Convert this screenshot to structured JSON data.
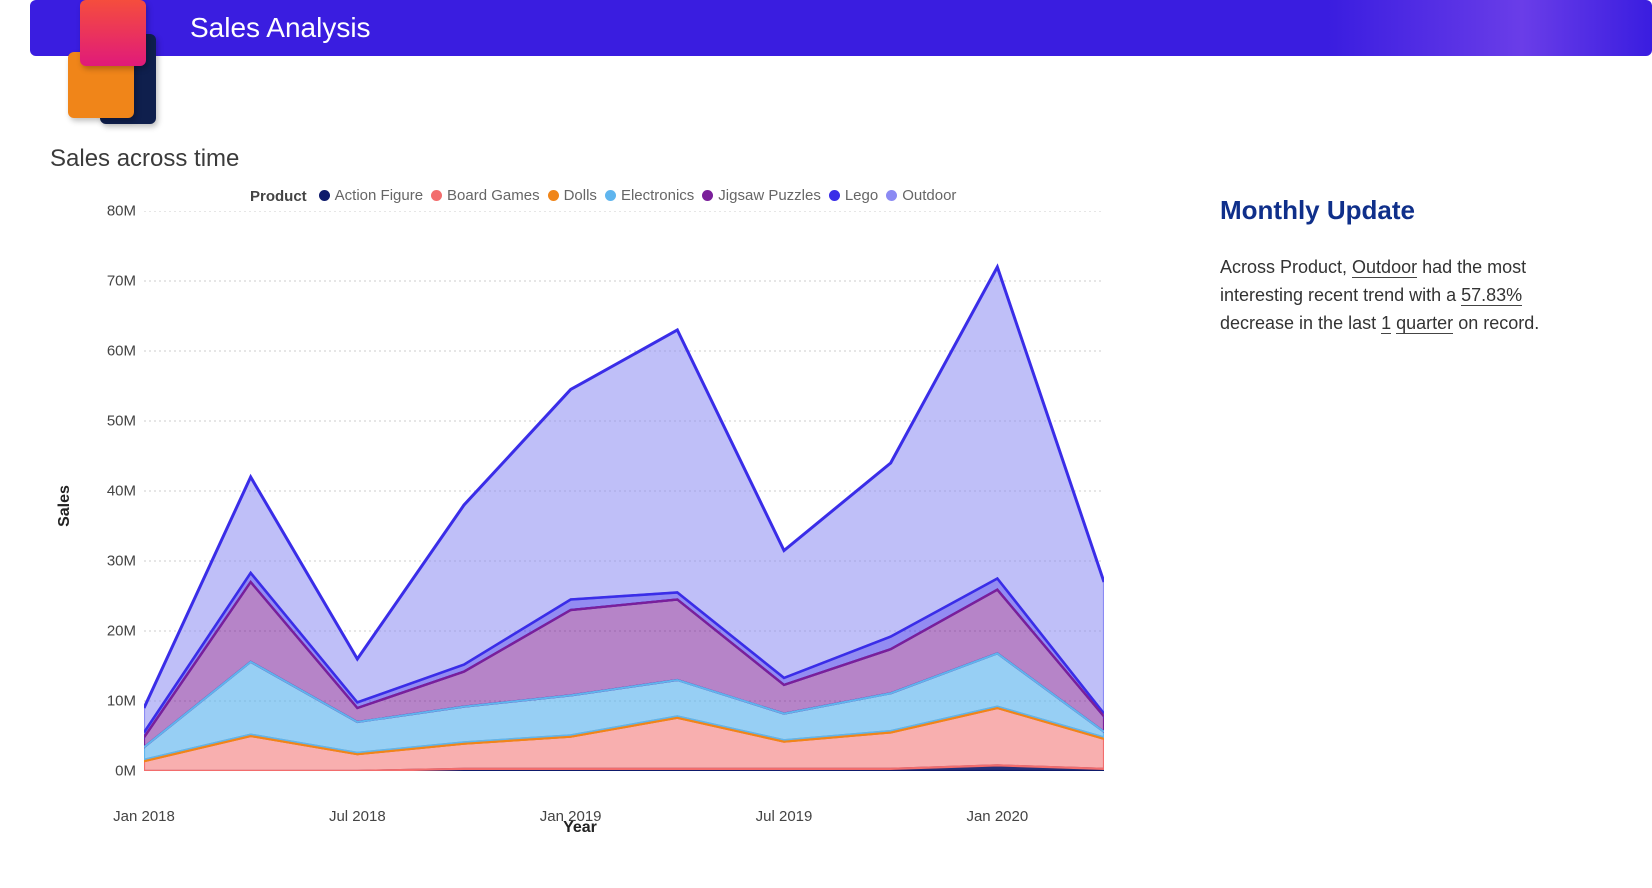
{
  "header": {
    "title": "Sales Analysis"
  },
  "chart": {
    "title": "Sales across time",
    "legend_label": "Product",
    "xlabel": "Year",
    "ylabel": "Sales"
  },
  "side": {
    "title": "Monthly Update",
    "line1a": "Across Product, ",
    "line1b": "Outdoor",
    "line1c": " had the most interesting recent trend with a ",
    "line2a": "57.83%",
    "line2b": " decrease in the last ",
    "line2c": "1",
    "line2d": " ",
    "line2e": "quarter",
    "line2f": " on record."
  },
  "chart_data": {
    "type": "area",
    "stacked": true,
    "xlabel": "Year",
    "ylabel": "Sales",
    "ylim": [
      0,
      80000000
    ],
    "y_ticks": [
      "0M",
      "10M",
      "20M",
      "30M",
      "40M",
      "50M",
      "60M",
      "70M",
      "80M"
    ],
    "x_ticks": [
      "Jan 2018",
      "Jul 2018",
      "Jan 2019",
      "Jul 2019",
      "Jan 2020"
    ],
    "categories": [
      "2018-01",
      "2018-04",
      "2018-07",
      "2018-10",
      "2019-01",
      "2019-04",
      "2019-07",
      "2019-10",
      "2020-01",
      "2020-04"
    ],
    "series": [
      {
        "name": "Action Figure",
        "color": "#0e1a6b",
        "values": [
          0,
          0,
          0,
          300000,
          300000,
          300000,
          300000,
          300000,
          800000,
          300000
        ]
      },
      {
        "name": "Board Games",
        "color": "#f26d6d",
        "values": [
          1400000,
          5000000,
          2400000,
          3600000,
          4600000,
          7300000,
          3900000,
          5200000,
          8200000,
          4300000
        ]
      },
      {
        "name": "Dolls",
        "color": "#f08519",
        "values": [
          200000,
          200000,
          200000,
          200000,
          200000,
          200000,
          200000,
          200000,
          200000,
          200000
        ]
      },
      {
        "name": "Electronics",
        "color": "#5fb5ee",
        "values": [
          1800000,
          10400000,
          4400000,
          5100000,
          5700000,
          5200000,
          3800000,
          5400000,
          7600000,
          800000
        ]
      },
      {
        "name": "Jigsaw Puzzles",
        "color": "#7a1f9a",
        "values": [
          1400000,
          11400000,
          2000000,
          5000000,
          12200000,
          11500000,
          4100000,
          6300000,
          9100000,
          2200000
        ]
      },
      {
        "name": "Lego",
        "color": "#3a2de8",
        "values": [
          700000,
          1300000,
          800000,
          1000000,
          1500000,
          1000000,
          1000000,
          1800000,
          1600000,
          400000
        ]
      },
      {
        "name": "Outdoor",
        "color": "#8b8af3",
        "values": [
          3500000,
          13700000,
          6200000,
          22800000,
          30000000,
          37500000,
          18200000,
          24800000,
          44500000,
          18800000
        ]
      }
    ],
    "title": "Sales across time"
  }
}
